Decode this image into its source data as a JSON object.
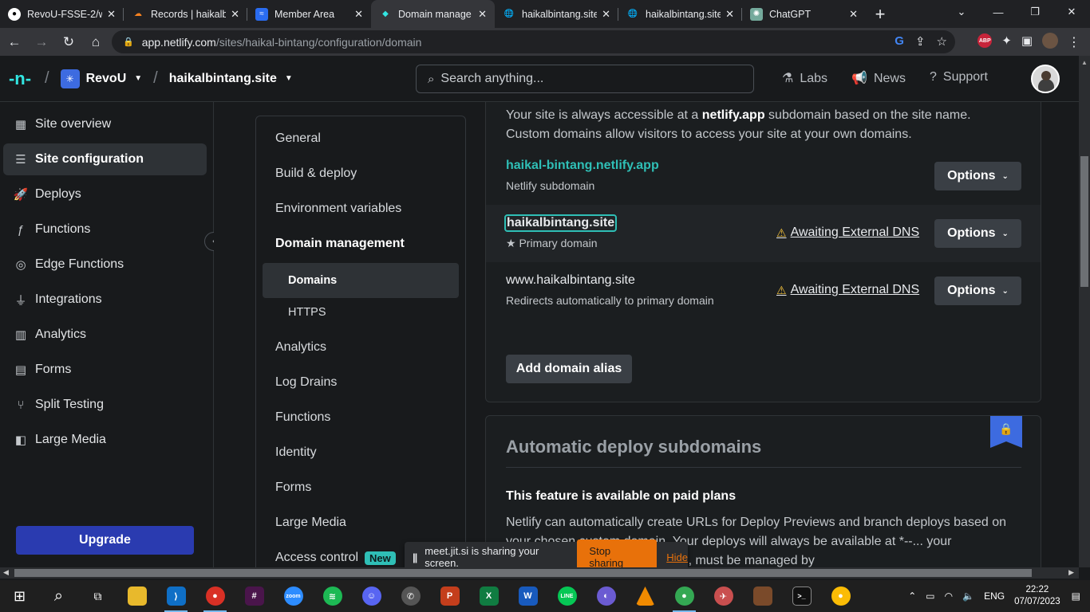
{
  "browser": {
    "tabs": [
      {
        "label": "RevoU-FSSE-2/w",
        "icon": "github-icon",
        "active": false
      },
      {
        "label": "Records | haikalb",
        "icon": "cloudflare-icon",
        "active": false
      },
      {
        "label": "Member Area",
        "icon": "member-area-icon",
        "active": false
      },
      {
        "label": "Domain manage",
        "icon": "netlify-icon",
        "active": true
      },
      {
        "label": "haikalbintang.site",
        "icon": "globe-icon",
        "active": false
      },
      {
        "label": "haikalbintang.site",
        "icon": "globe-icon",
        "active": false
      },
      {
        "label": "ChatGPT",
        "icon": "chatgpt-icon",
        "active": false
      }
    ],
    "url_host": "app.netlify.com",
    "url_path": "/sites/haikal-bintang/configuration/domain"
  },
  "header": {
    "team": "RevoU",
    "site": "haikalbintang.site",
    "search_placeholder": "Search anything...",
    "links": [
      {
        "label": "Labs",
        "icon": "flask-icon"
      },
      {
        "label": "News",
        "icon": "megaphone-icon"
      },
      {
        "label": "Support",
        "icon": "help-circle-icon"
      }
    ]
  },
  "sidebar": {
    "items": [
      {
        "label": "Site overview",
        "icon": "grid-icon"
      },
      {
        "label": "Site configuration",
        "icon": "settings-icon"
      },
      {
        "label": "Deploys",
        "icon": "rocket-icon"
      },
      {
        "label": "Functions",
        "icon": "function-icon"
      },
      {
        "label": "Edge Functions",
        "icon": "globe-icon"
      },
      {
        "label": "Integrations",
        "icon": "plug-icon"
      },
      {
        "label": "Analytics",
        "icon": "bar-chart-icon"
      },
      {
        "label": "Forms",
        "icon": "form-icon"
      },
      {
        "label": "Split Testing",
        "icon": "split-icon"
      },
      {
        "label": "Large Media",
        "icon": "media-icon"
      }
    ],
    "upgrade_label": "Upgrade"
  },
  "subnav": {
    "items": [
      {
        "label": "General"
      },
      {
        "label": "Build & deploy"
      },
      {
        "label": "Environment variables"
      },
      {
        "label": "Domain management"
      },
      {
        "label": "Domains"
      },
      {
        "label": "HTTPS"
      },
      {
        "label": "Analytics"
      },
      {
        "label": "Log Drains"
      },
      {
        "label": "Functions"
      },
      {
        "label": "Identity"
      },
      {
        "label": "Forms"
      },
      {
        "label": "Large Media"
      },
      {
        "label": "Access control"
      }
    ],
    "new_badge": "New"
  },
  "domains_card": {
    "intro_prefix": "Your site is always accessible at a",
    "intro_bold": "netlify.app",
    "intro_suffix": "subdomain based on the site name. Custom domains allow visitors to access your site at your own domains.",
    "rows": [
      {
        "name": "haikal-bintang.netlify.app",
        "sub": "Netlify subdomain",
        "status": "",
        "options": "Options"
      },
      {
        "name": "haikalbintang.site",
        "sub": "Primary domain",
        "status": "Awaiting External DNS",
        "options": "Options"
      },
      {
        "name": "www.haikalbintang.site",
        "sub": "Redirects automatically to primary domain",
        "status": "Awaiting External DNS",
        "options": "Options"
      }
    ],
    "add_alias": "Add domain alias"
  },
  "deploy_card": {
    "title": "Automatic deploy subdomains",
    "paid": "This feature is available on paid plans",
    "text": "Netlify can automatically create URLs for Deploy Previews and branch deploys based on your chosen custom domain. Your deploys will always be available at *--... your subdomain, or its parent domain, must be managed by"
  },
  "sharebar": {
    "message": "meet.jit.si is sharing your screen.",
    "stop": "Stop sharing",
    "hide": "Hide"
  },
  "taskbar": {
    "lang": "ENG",
    "time": "22:22",
    "date": "07/07/2023"
  }
}
